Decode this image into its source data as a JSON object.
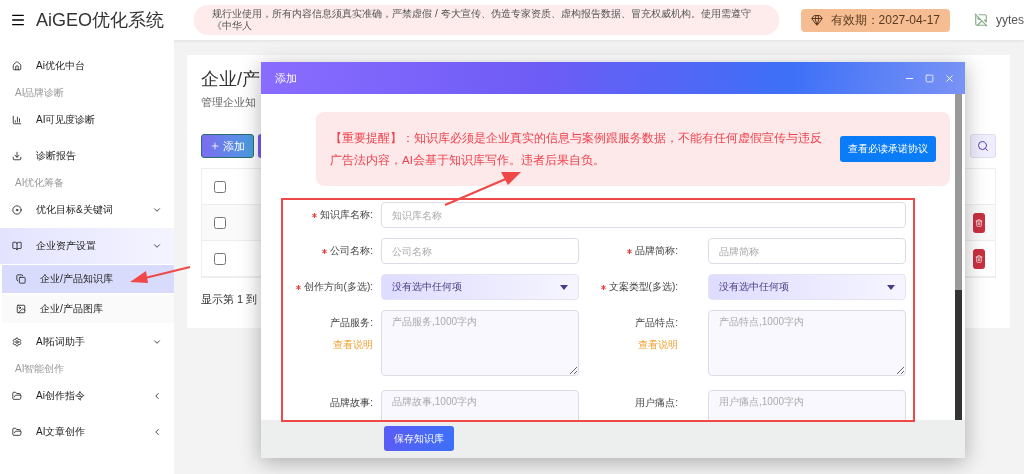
{
  "header": {
    "title": "AiGEO优化系统",
    "notice": "规行业使用，所有内容信息须真实准确，严禁虚假 / 夸大宣传、伪造专家资质、虚构报告数据、冒充权威机构。使用需遵守《中华人",
    "validity": "有效期：2027-04-17",
    "user": "yytes"
  },
  "sidebar": {
    "items": [
      {
        "kind": "item",
        "label": "Ai优化中台"
      },
      {
        "kind": "section",
        "label": "AI品牌诊断"
      },
      {
        "kind": "item",
        "label": "AI可见度诊断"
      },
      {
        "kind": "item",
        "label": "诊断报告"
      },
      {
        "kind": "section",
        "label": "AI优化筹备"
      },
      {
        "kind": "dropdown",
        "label": "优化目标&关键词"
      },
      {
        "kind": "group",
        "label": "企业资产设置",
        "selected": true,
        "expanded": true,
        "children": [
          {
            "label": "企业/产品知识库",
            "selected": true
          },
          {
            "label": "企业/产品图库",
            "selected": false
          }
        ]
      },
      {
        "kind": "dropdown",
        "label": "AI拓词助手"
      },
      {
        "kind": "section",
        "label": "AI智能创作"
      },
      {
        "kind": "collapsible",
        "label": "Ai创作指令"
      },
      {
        "kind": "collapsible",
        "label": "AI文章创作"
      }
    ]
  },
  "page": {
    "title": "企业/产",
    "subtitle": "管理企业知",
    "add_button": "添加",
    "select_all_checked": false,
    "rows": [
      {
        "checked": false
      },
      {
        "checked": false
      }
    ],
    "pagination": "显示第 1 到"
  },
  "modal": {
    "title": "添加",
    "notice": "【重要提醒】：知识库必须是企业真实的信息与案例跟服务数据，不能有任何虚假宣传与违反广告法内容，AI会基于知识库写作。违者后果自负。",
    "notice_button": "查看必读承诺协议",
    "rows": [
      [
        {
          "kind": "text",
          "label": "知识库名称:",
          "required": true,
          "placeholder": "知识库名称"
        }
      ],
      [
        {
          "kind": "text",
          "label": "公司名称:",
          "required": true,
          "placeholder": "公司名称"
        },
        {
          "kind": "text",
          "label": "品牌简称:",
          "required": true,
          "placeholder": "品牌简称"
        }
      ],
      [
        {
          "kind": "select",
          "label": "创作方向(多选):",
          "required": true,
          "value": "没有选中任何项"
        },
        {
          "kind": "select",
          "label": "文案类型(多选):",
          "required": true,
          "value": "没有选中任何项"
        }
      ],
      [
        {
          "kind": "textarea",
          "label": "产品服务:",
          "placeholder": "产品服务,1000字内",
          "help": "查看说明"
        },
        {
          "kind": "textarea",
          "label": "产品特点:",
          "placeholder": "产品特点,1000字内",
          "help": "查看说明"
        }
      ],
      [
        {
          "kind": "textarea",
          "label": "品牌故事:",
          "placeholder": "品牌故事,1000字内"
        },
        {
          "kind": "textarea",
          "label": "用户痛点:",
          "placeholder": "用户痛点,1000字内"
        }
      ]
    ],
    "save_button": "保存知识库"
  }
}
